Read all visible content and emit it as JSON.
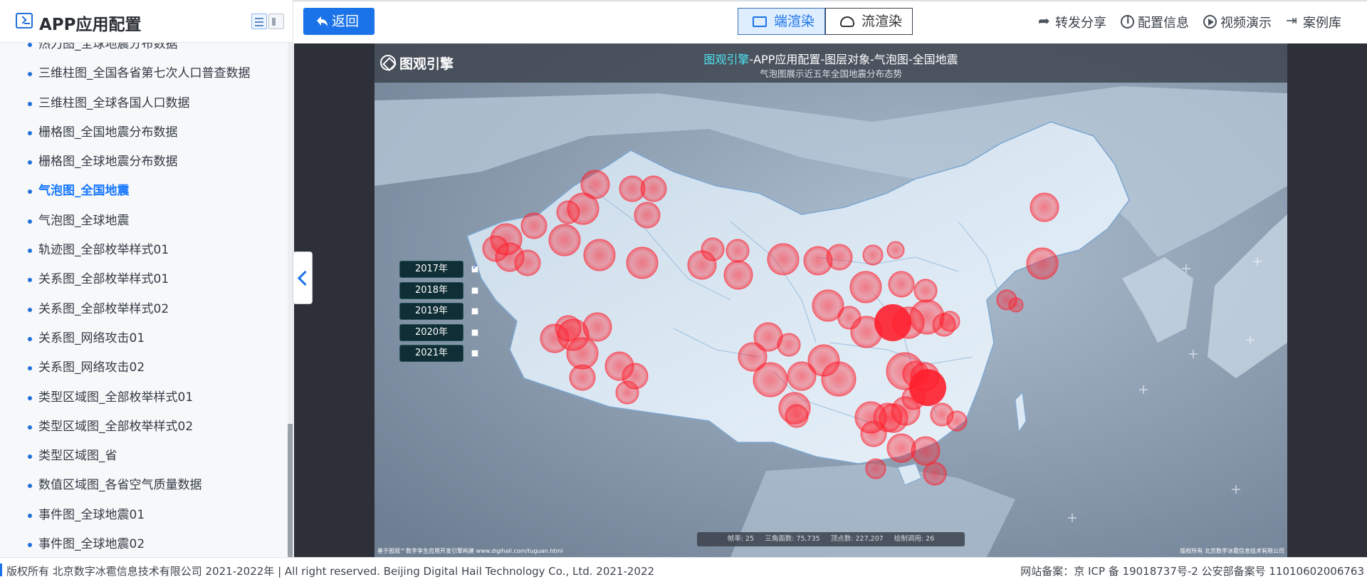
{
  "sidebar": {
    "title": "APP应用配置",
    "items": [
      {
        "label": "热力图_全球地震分布数据",
        "active": false
      },
      {
        "label": "三维柱图_全国各省第七次人口普查数据",
        "active": false
      },
      {
        "label": "三维柱图_全球各国人口数据",
        "active": false
      },
      {
        "label": "栅格图_全国地震分布数据",
        "active": false
      },
      {
        "label": "栅格图_全球地震分布数据",
        "active": false
      },
      {
        "label": "气泡图_全国地震",
        "active": true
      },
      {
        "label": "气泡图_全球地震",
        "active": false
      },
      {
        "label": "轨迹图_全部枚举样式01",
        "active": false
      },
      {
        "label": "关系图_全部枚举样式01",
        "active": false
      },
      {
        "label": "关系图_全部枚举样式02",
        "active": false
      },
      {
        "label": "关系图_网络攻击01",
        "active": false
      },
      {
        "label": "关系图_网络攻击02",
        "active": false
      },
      {
        "label": "类型区域图_全部枚举样式01",
        "active": false
      },
      {
        "label": "类型区域图_全部枚举样式02",
        "active": false
      },
      {
        "label": "类型区域图_省",
        "active": false
      },
      {
        "label": "数值区域图_各省空气质量数据",
        "active": false
      },
      {
        "label": "事件图_全球地震01",
        "active": false
      },
      {
        "label": "事件图_全球地震02",
        "active": false
      }
    ]
  },
  "toolbar": {
    "back_label": "返回",
    "render_client": "端渲染",
    "render_stream": "流渲染",
    "share": "转发分享",
    "config_info": "配置信息",
    "video_demo": "视频演示",
    "case_library": "案例库"
  },
  "viewport": {
    "brand": "图观引擎",
    "title_highlight": "图观引擎",
    "title_rest": "-APP应用配置-图层对象-气泡图-全国地震",
    "subtitle": "气泡图展示近五年全国地震分布态势",
    "years": [
      {
        "label": "2017年",
        "checked": true
      },
      {
        "label": "2018年",
        "checked": false
      },
      {
        "label": "2019年",
        "checked": false
      },
      {
        "label": "2020年",
        "checked": false
      },
      {
        "label": "2021年",
        "checked": false
      }
    ],
    "stats": {
      "fps_label": "帧率:",
      "fps": "25",
      "triangles_label": "三角面数:",
      "triangles": "75,735",
      "vertices_label": "顶点数:",
      "vertices": "227,207",
      "drawcalls_label": "绘制调用:",
      "drawcalls": "26"
    },
    "footer_left": "基于图观™数字孪生应用开发引擎构建 www.digihail.com/tuguan.html",
    "footer_right": "版权所有 北京数字冰雹信息技术有限公司",
    "colors": {
      "bubble": "#ff1f2d",
      "title_highlight": "#4fe3f0"
    }
  },
  "footer": {
    "copyright": "版权所有 北京数字冰雹信息技术有限公司 2021-2022年 | All right reserved. Beijing Digital Hail Technology Co., Ltd. 2021-2022",
    "icp": "网站备案：京 ICP 备 19018737号-2 公安部备案号 11010602006763"
  }
}
